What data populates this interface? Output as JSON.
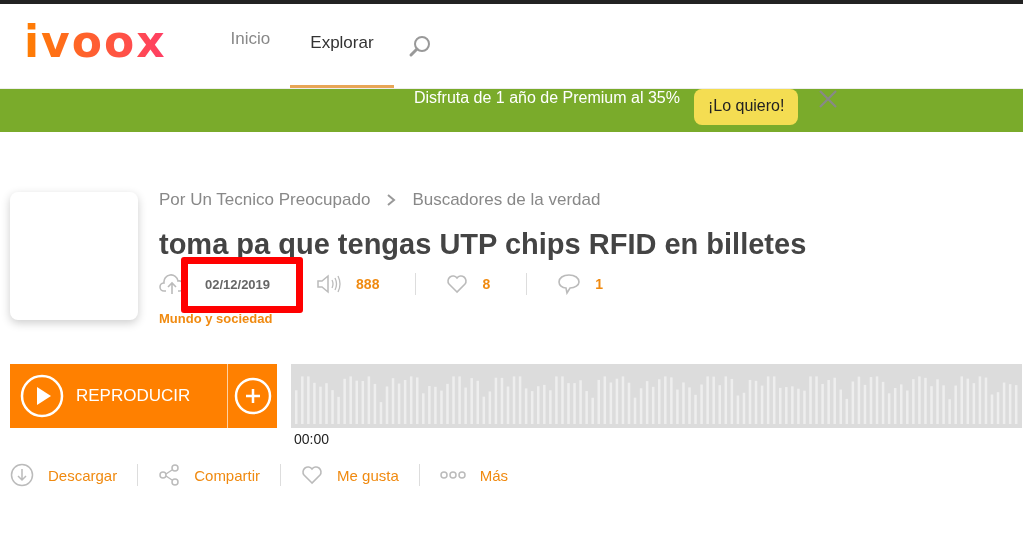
{
  "logo": "ivoox",
  "nav": [
    {
      "label": "Inicio",
      "selected": false
    },
    {
      "label": "Explorar",
      "selected": true
    }
  ],
  "banner": {
    "text": "Disfruta de 1 año de Premium al 35%",
    "button": "¡Lo quiero!"
  },
  "breadcrumb": [
    "Por Un Tecnico Preocupado",
    "Buscadores de la verdad"
  ],
  "title": "toma pa que tengas UTP chips RFID en billetes",
  "date": {
    "text": "02/12/2019",
    "highlighted": true
  },
  "stats": [
    {
      "kind": "plays",
      "value": "888"
    },
    {
      "kind": "likes",
      "value": "8"
    },
    {
      "kind": "comments",
      "value": "1"
    }
  ],
  "category": "Mundo y sociedad",
  "player": {
    "play": "REPRODUCIR",
    "time": "00:00"
  },
  "actions": [
    {
      "kind": "download",
      "label": "Descargar"
    },
    {
      "kind": "share",
      "label": "Compartir"
    },
    {
      "kind": "like",
      "label": "Me gusta"
    },
    {
      "kind": "more",
      "label": "Más"
    }
  ]
}
